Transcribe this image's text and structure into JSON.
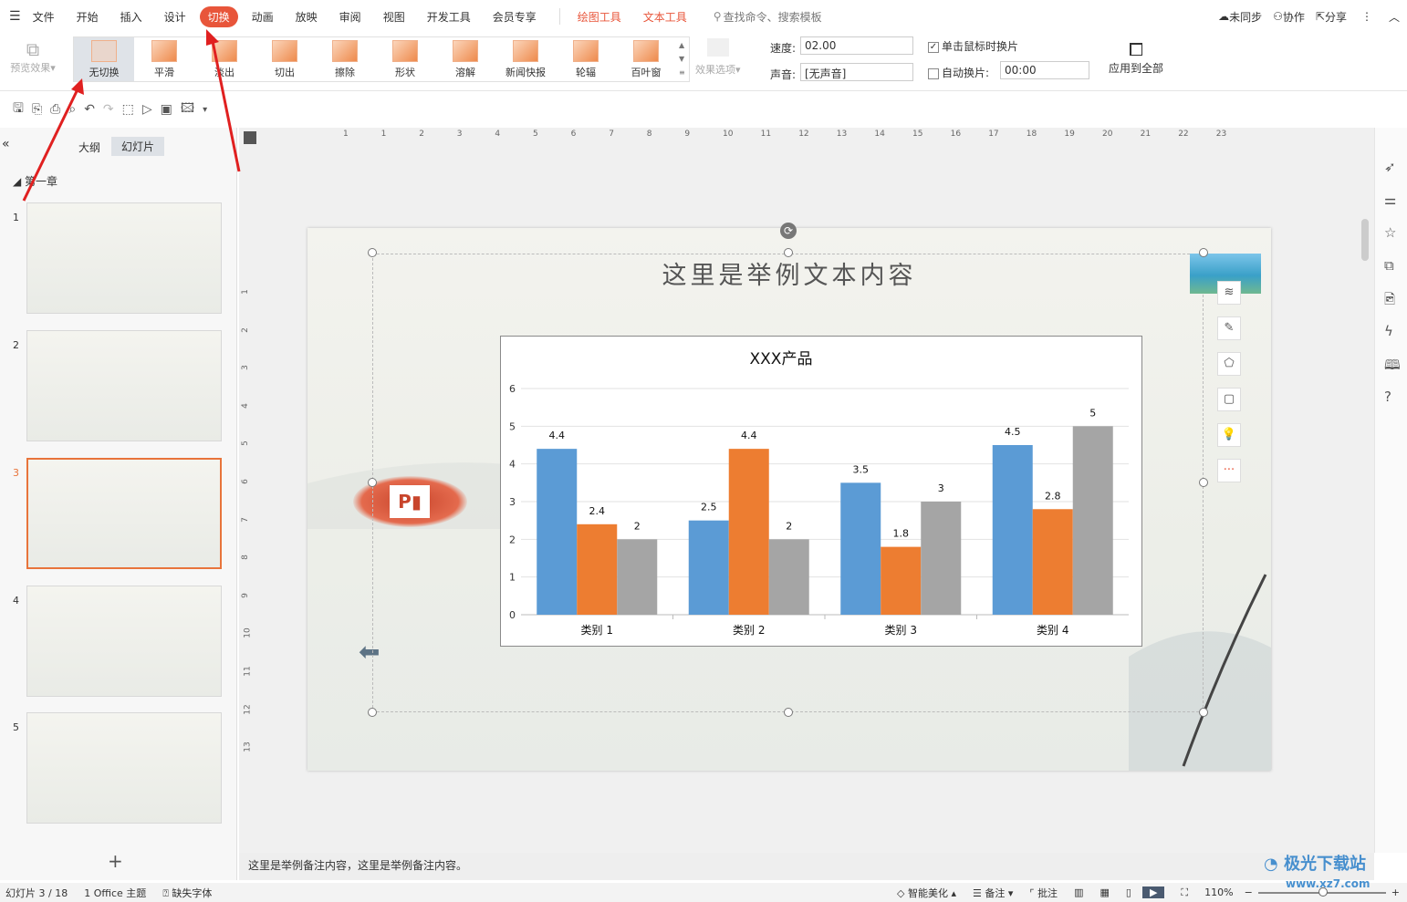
{
  "menu": {
    "items": [
      "文件",
      "开始",
      "插入",
      "设计",
      "切换",
      "动画",
      "放映",
      "审阅",
      "视图",
      "开发工具",
      "会员专享"
    ],
    "context_tabs": [
      "绘图工具",
      "文本工具"
    ],
    "search": "查找命令、搜索模板",
    "sync": "未同步",
    "collab": "协作",
    "share": "分享"
  },
  "ribbon": {
    "preview": "预览效果",
    "transitions": [
      "无切换",
      "平滑",
      "淡出",
      "切出",
      "擦除",
      "形状",
      "溶解",
      "新闻快报",
      "轮辐",
      "百叶窗"
    ],
    "effect_options": "效果选项",
    "speed_label": "速度:",
    "speed_value": "02.00",
    "sound_label": "声音:",
    "sound_value": "[无声音]",
    "on_click": "单击鼠标时换片",
    "on_click_checked": true,
    "auto_label": "自动换片:",
    "auto_checked": false,
    "auto_value": "00:00",
    "apply_all": "应用到全部"
  },
  "panel": {
    "tabs": [
      "大纲",
      "幻灯片"
    ],
    "section": "第一章",
    "slides": [
      "1",
      "2",
      "3",
      "4",
      "5"
    ],
    "selected": 3
  },
  "slide": {
    "title": "这里是举例文本内容"
  },
  "chart_data": {
    "type": "bar",
    "title": "XXX产品",
    "categories": [
      "类别 1",
      "类别 2",
      "类别 3",
      "类别 4"
    ],
    "series": [
      {
        "values": [
          4.4,
          2.5,
          3.5,
          4.5
        ],
        "color": "#5b9bd5"
      },
      {
        "values": [
          2.4,
          4.4,
          1.8,
          2.8
        ],
        "color": "#ed7d31"
      },
      {
        "values": [
          2,
          2,
          3,
          5
        ],
        "color": "#a5a5a5"
      }
    ],
    "ylim": [
      0,
      6
    ],
    "yticks": [
      0,
      1,
      2,
      3,
      4,
      5,
      6
    ],
    "grid": true,
    "legend": "none"
  },
  "notes": "这里是举例备注内容，这里是举例备注内容。",
  "status": {
    "slide": "幻灯片 3 / 18",
    "theme": "1 Office 主题",
    "font": "缺失字体",
    "beautify": "智能美化",
    "notes": "备注",
    "comment": "批注",
    "zoom": "110%"
  },
  "ruler": [
    "1",
    "1",
    "2",
    "3",
    "4",
    "5",
    "6",
    "7",
    "8",
    "9",
    "10",
    "11",
    "12",
    "13",
    "14",
    "15",
    "16",
    "17",
    "18",
    "19",
    "20",
    "21",
    "22",
    "23"
  ],
  "vruler": [
    "1",
    "2",
    "3",
    "4",
    "5",
    "6",
    "7",
    "8",
    "9",
    "10",
    "11",
    "12",
    "13"
  ],
  "watermark": "极光下载站 www.xz7.com"
}
